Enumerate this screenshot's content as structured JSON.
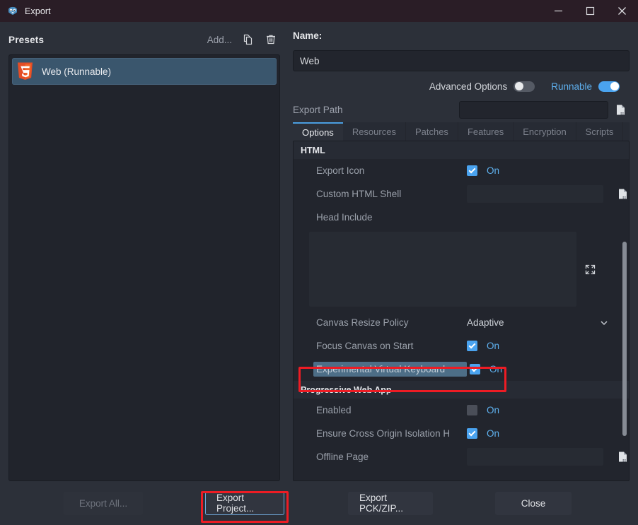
{
  "window": {
    "title": "Export",
    "app_icon": "godot-icon",
    "controls": {
      "minimize": "minimize-icon",
      "maximize": "maximize-icon",
      "close": "close-icon"
    }
  },
  "presets": {
    "title": "Presets",
    "add_label": "Add...",
    "duplicate_icon": "duplicate-icon",
    "delete_icon": "trash-icon",
    "items": [
      {
        "label": "Web (Runnable)",
        "icon": "html5-icon",
        "selected": true
      }
    ]
  },
  "config": {
    "name_label": "Name:",
    "name_value": "Web",
    "advanced_options_label": "Advanced Options",
    "advanced_options_on": false,
    "runnable_label": "Runnable",
    "runnable_on": true,
    "export_path_label": "Export Path",
    "export_path_value": "",
    "export_path_browse_icon": "file-browse-icon"
  },
  "tabs": [
    {
      "label": "Options",
      "active": true
    },
    {
      "label": "Resources",
      "active": false
    },
    {
      "label": "Patches",
      "active": false
    },
    {
      "label": "Features",
      "active": false
    },
    {
      "label": "Encryption",
      "active": false
    },
    {
      "label": "Scripts",
      "active": false
    }
  ],
  "options": {
    "sections": [
      {
        "header": "HTML",
        "rows": [
          {
            "name": "Export Icon",
            "type": "checkbox",
            "checked": true,
            "value_label": "On"
          },
          {
            "name": "Custom HTML Shell",
            "type": "file",
            "value": "",
            "icon": "file-browse-icon"
          },
          {
            "name": "Head Include",
            "type": "label-only"
          },
          {
            "name": "",
            "type": "textarea",
            "value": "",
            "icon": "expand-icon"
          },
          {
            "name": "Canvas Resize Policy",
            "type": "dropdown",
            "value": "Adaptive",
            "icon": "chevron-down-icon"
          },
          {
            "name": "Focus Canvas on Start",
            "type": "checkbox",
            "checked": true,
            "value_label": "On"
          },
          {
            "name": "Experimental Virtual Keyboard",
            "type": "checkbox",
            "checked": true,
            "value_label": "On",
            "highlighted": true,
            "annotated": true
          }
        ]
      },
      {
        "header": "Progressive Web App",
        "rows": [
          {
            "name": "Enabled",
            "type": "checkbox",
            "checked": false,
            "value_label": "On"
          },
          {
            "name": "Ensure Cross Origin Isolation H",
            "type": "checkbox",
            "checked": true,
            "value_label": "On"
          },
          {
            "name": "Offline Page",
            "type": "file",
            "value": "",
            "icon": "file-browse-icon"
          }
        ]
      }
    ]
  },
  "footer": {
    "export_all": "Export All...",
    "export_all_disabled": true,
    "export_project": "Export Project...",
    "export_project_focused": true,
    "export_project_annotated": true,
    "export_pck": "Export PCK/ZIP...",
    "close": "Close"
  },
  "colors": {
    "accent_blue": "#4aa3ef",
    "annotation_red": "#ed1c24",
    "selection_blue": "#3a566d",
    "panel_bg": "#22252d",
    "window_bg": "#2c3039",
    "titlebar_bg": "#2a1d26"
  }
}
